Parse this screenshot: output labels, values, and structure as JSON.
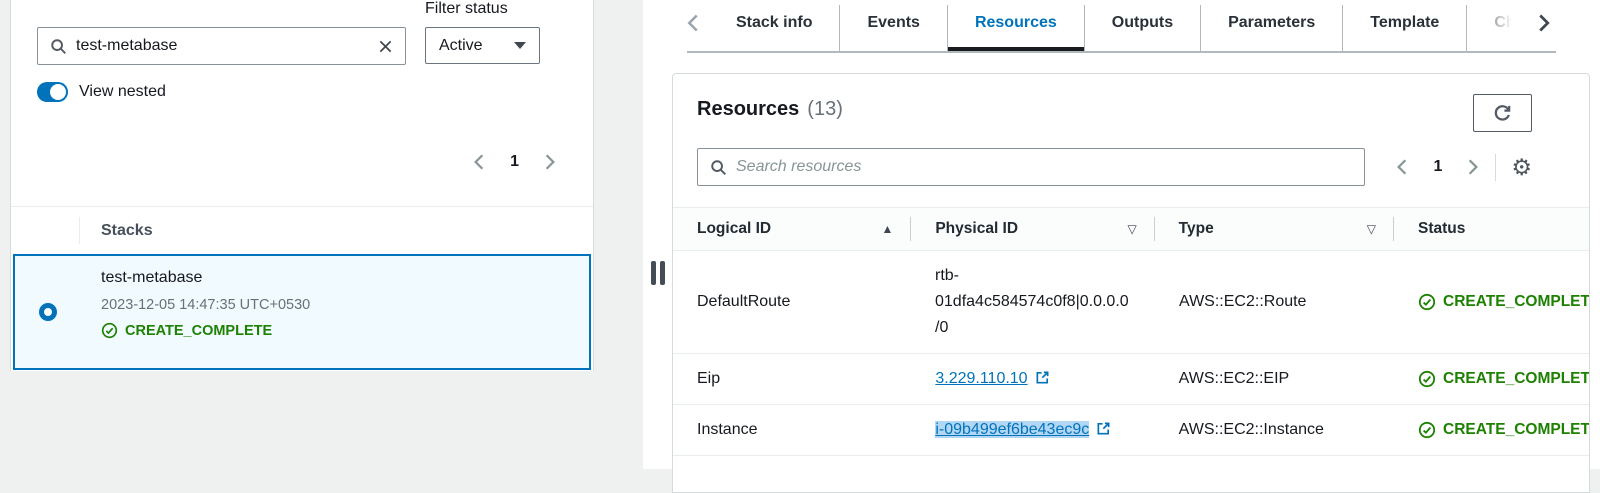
{
  "colors": {
    "accent": "#0073bb",
    "link": "#0073bb",
    "success": "#1d8102",
    "selection": "#b1d7f5",
    "tab_underline": "#181c20"
  },
  "left_panel": {
    "search": {
      "value": "test-metabase"
    },
    "filter": {
      "label": "Filter status",
      "selected": "Active"
    },
    "view_nested": {
      "label": "View nested",
      "on": true
    },
    "pagination": {
      "current": "1"
    },
    "stacks_table": {
      "header": "Stacks"
    },
    "selected_stack": {
      "name": "test-metabase",
      "timestamp": "2023-12-05 14:47:35 UTC+0530",
      "status": "CREATE_COMPLETE"
    }
  },
  "tabs": {
    "items": [
      {
        "label": "Stack info",
        "active": false
      },
      {
        "label": "Events",
        "active": false
      },
      {
        "label": "Resources",
        "active": true
      },
      {
        "label": "Outputs",
        "active": false
      },
      {
        "label": "Parameters",
        "active": false
      },
      {
        "label": "Template",
        "active": false
      },
      {
        "label": "Cha",
        "active": false
      }
    ]
  },
  "resources": {
    "title": "Resources",
    "count": "(13)",
    "search_placeholder": "Search resources",
    "pagination": {
      "current": "1"
    },
    "columns": [
      {
        "label": "Logical ID",
        "sort_glyph": "▲"
      },
      {
        "label": "Physical ID",
        "sort_glyph": "▽"
      },
      {
        "label": "Type",
        "sort_glyph": "▽"
      },
      {
        "label": "Status",
        "sort_glyph": ""
      }
    ],
    "rows": [
      {
        "logical_id": "DefaultRoute",
        "physical_id": "rtb-01dfa4c584574c0f8|0.0.0.0/0",
        "physical_link": false,
        "highlighted": false,
        "type": "AWS::EC2::Route",
        "status": "CREATE_COMPLETE"
      },
      {
        "logical_id": "Eip",
        "physical_id": "3.229.110.10",
        "physical_link": true,
        "highlighted": false,
        "type": "AWS::EC2::EIP",
        "status": "CREATE_COMPLETE"
      },
      {
        "logical_id": "Instance",
        "physical_id": "i-09b499ef6be43ec9c",
        "physical_link": true,
        "highlighted": true,
        "type": "AWS::EC2::Instance",
        "status": "CREATE_COMPLETE"
      }
    ]
  }
}
